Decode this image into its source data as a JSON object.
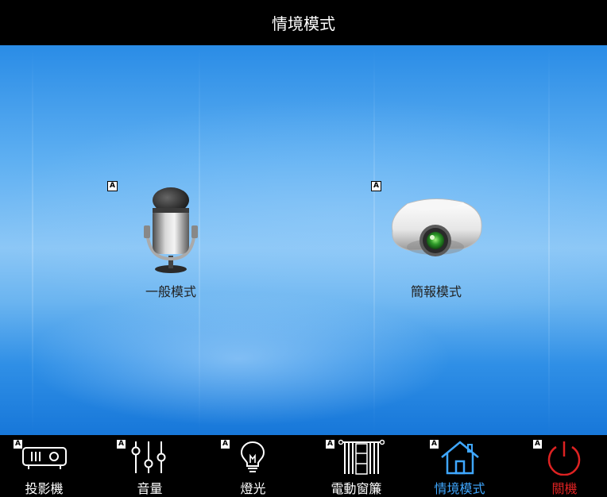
{
  "header": {
    "title": "情境模式"
  },
  "badge_text": "A",
  "modes": [
    {
      "label": "一般模式",
      "icon": "microphone-icon"
    },
    {
      "label": "簡報模式",
      "icon": "projector-icon"
    }
  ],
  "nav": [
    {
      "label": "投影機",
      "icon": "projector-front-icon",
      "badge": "A"
    },
    {
      "label": "音量",
      "icon": "volume-sliders-icon",
      "badge": "A"
    },
    {
      "label": "燈光",
      "icon": "light-bulb-icon",
      "badge": "A"
    },
    {
      "label": "電動窗簾",
      "icon": "curtain-icon",
      "badge": "A"
    },
    {
      "label": "情境模式",
      "icon": "home-icon",
      "badge": "A",
      "active": true
    },
    {
      "label": "關機",
      "icon": "power-icon",
      "badge": "A"
    }
  ],
  "colors": {
    "active": "#3fa7ff",
    "power": "#dd2222",
    "header_bg": "#000000"
  }
}
